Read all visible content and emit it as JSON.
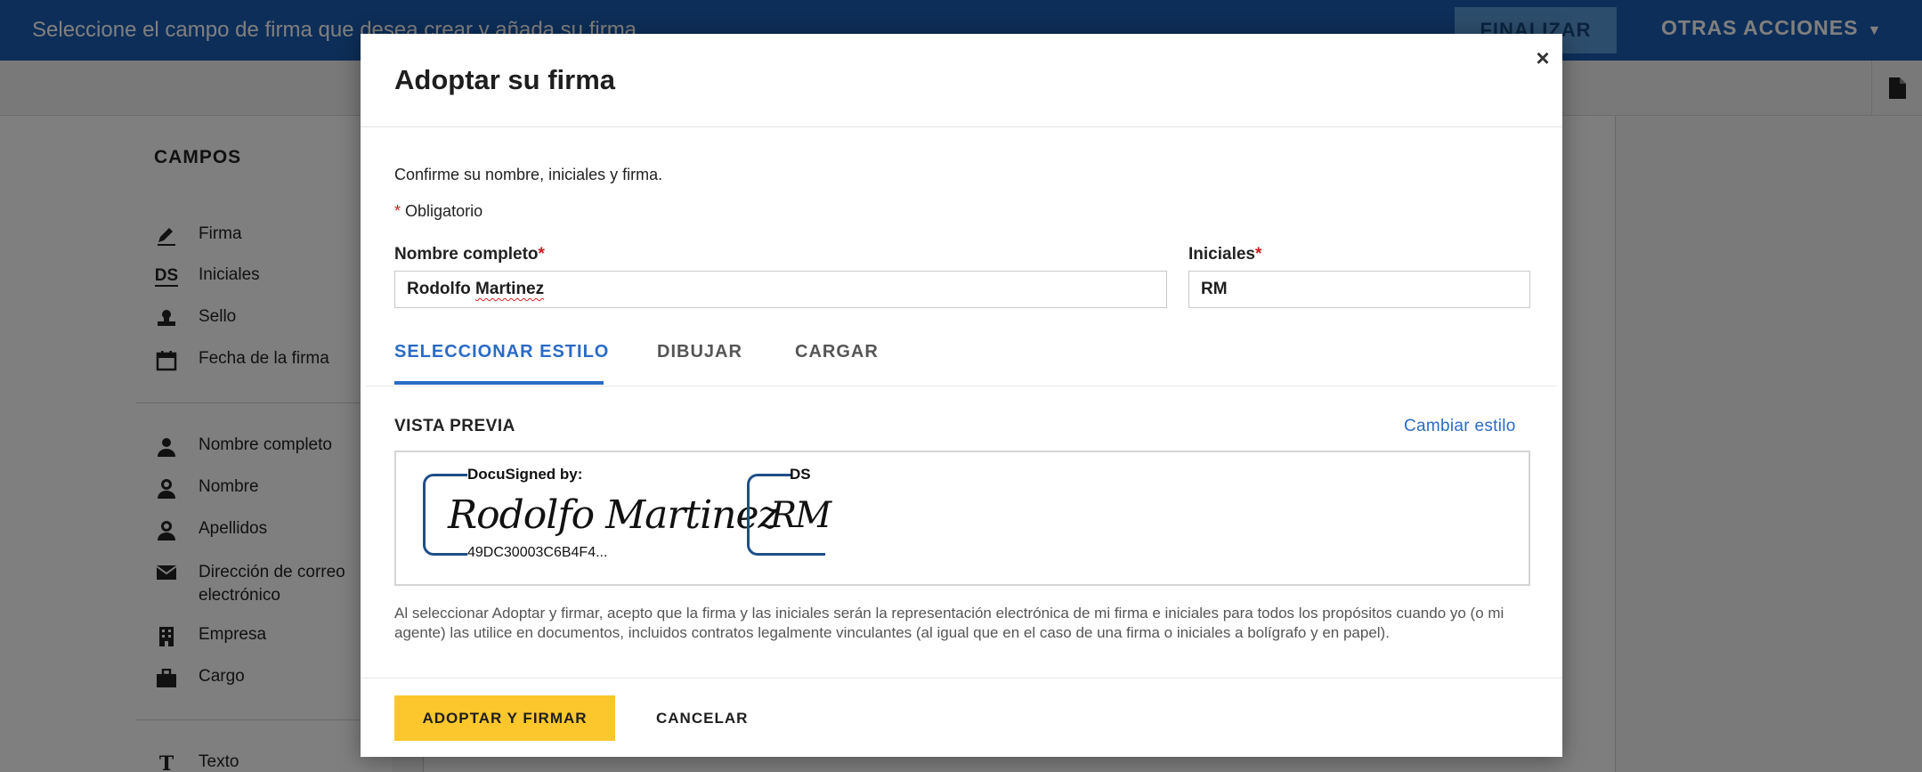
{
  "topbar": {
    "message": "Seleccione el campo de firma que desea crear y añada su firma",
    "finalize_label": "FINALIZAR",
    "other_actions_label": "OTRAS ACCIONES",
    "caret": "▼"
  },
  "sidebar": {
    "title": "CAMPOS",
    "items": [
      {
        "label": "Firma",
        "icon": "pen-icon"
      },
      {
        "label": "Iniciales",
        "icon": "initials-icon",
        "glyph": "DS"
      },
      {
        "label": "Sello",
        "icon": "stamp-icon"
      },
      {
        "label": "Fecha de la firma",
        "icon": "calendar-icon"
      },
      {
        "label": "Nombre completo",
        "icon": "person-icon"
      },
      {
        "label": "Nombre",
        "icon": "person-outline-icon"
      },
      {
        "label": "Apellidos",
        "icon": "person-outline-icon"
      },
      {
        "label": "Dirección de correo electrónico",
        "icon": "envelope-icon"
      },
      {
        "label": "Empresa",
        "icon": "building-icon"
      },
      {
        "label": "Cargo",
        "icon": "briefcase-icon"
      },
      {
        "label": "Texto",
        "icon": "text-icon",
        "glyph": "T"
      }
    ]
  },
  "modal": {
    "title": "Adoptar su firma",
    "close_glyph": "×",
    "intro": "Confirme su nombre, iniciales y firma.",
    "required_star": "*",
    "required_note": "Obligatorio",
    "full_name_label": "Nombre completo",
    "initials_label": "Iniciales",
    "full_name_value": "Rodolfo Martinez",
    "initials_value": "RM",
    "tabs": [
      {
        "label": "SELECCIONAR ESTILO",
        "active": true
      },
      {
        "label": "DIBUJAR",
        "active": false
      },
      {
        "label": "CARGAR",
        "active": false
      }
    ],
    "preview_label": "VISTA PREVIA",
    "change_style_label": "Cambiar estilo",
    "signature": {
      "header": "DocuSigned by:",
      "handwritten": "Rodolfo Martinez",
      "envelope_id": "49DC30003C6B4F4..."
    },
    "initials_stamp": {
      "header": "DS",
      "handwritten": "RM"
    },
    "legal_text": "Al seleccionar Adoptar y firmar, acepto que la firma y las iniciales serán la representación electrónica de mi firma e iniciales para todos los propósitos cuando yo (o mi agente) las utilice en documentos, incluidos contratos legalmente vinculantes (al igual que en el caso de una firma o iniciales a bolígrafo y en papel).",
    "adopt_label": "ADOPTAR Y FIRMAR",
    "cancel_label": "CANCELAR"
  },
  "colors": {
    "topbar": "#1a5cb0",
    "accent": "#2b6bc4",
    "primary_button": "#fcc62d",
    "required": "#c81e1e",
    "signature_frame": "#1f4e88"
  }
}
